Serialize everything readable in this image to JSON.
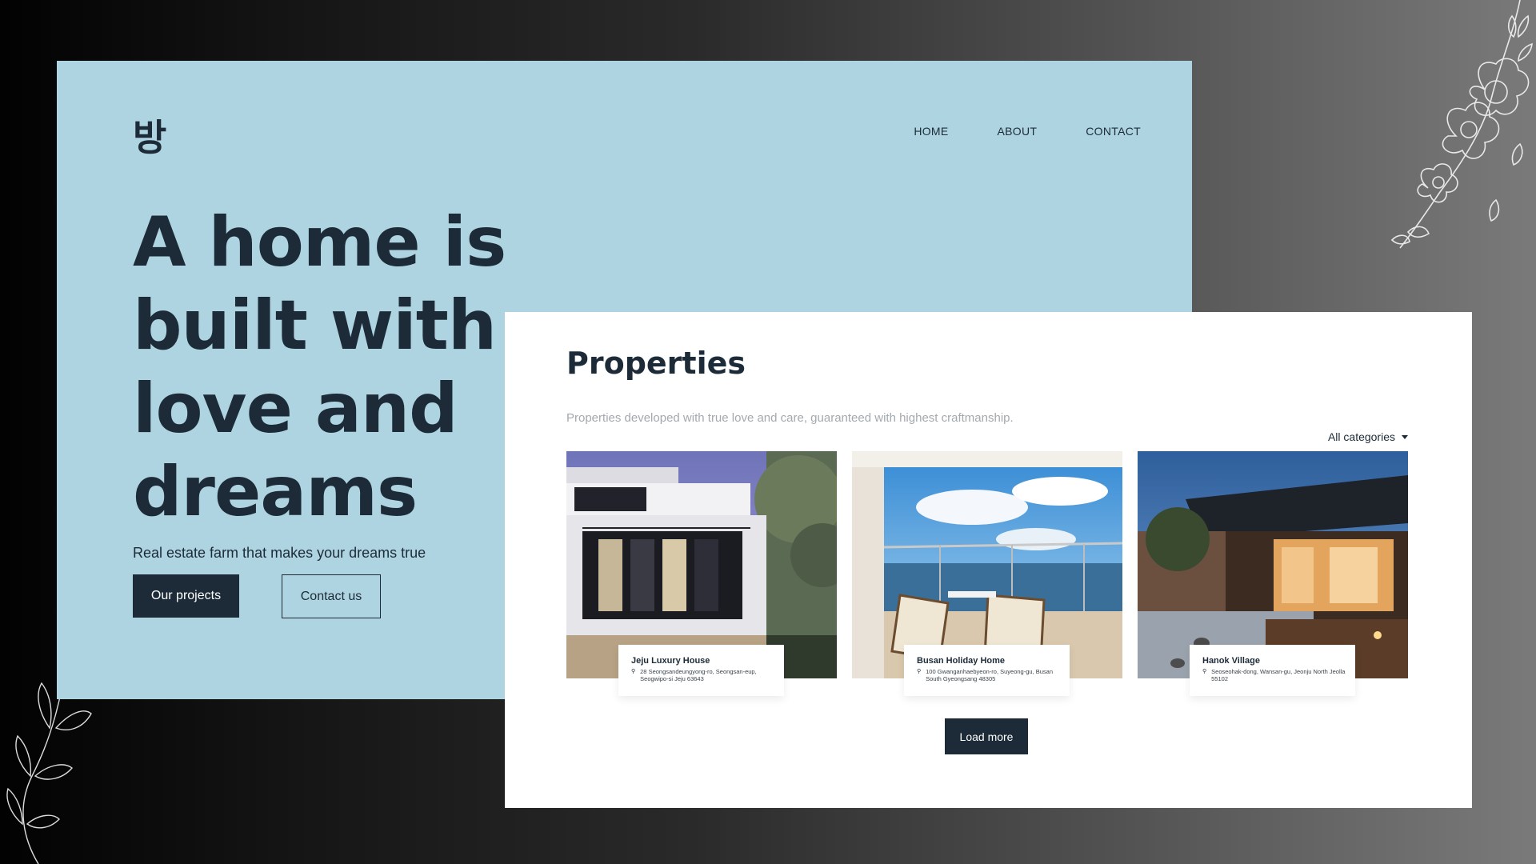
{
  "brand": {
    "logo": "방"
  },
  "nav": {
    "items": [
      "HOME",
      "ABOUT",
      "CONTACT"
    ]
  },
  "hero": {
    "headline": "A home is built with love and dreams",
    "tagline": "Real estate farm that makes your dreams true",
    "primary_button": "Our projects",
    "secondary_button": "Contact us"
  },
  "properties": {
    "title": "Properties",
    "subtitle": "Properties developed with true love and care, guaranteed with highest craftmanship.",
    "filter": {
      "selected": "All categories"
    },
    "cards": [
      {
        "name": "Jeju Luxury House",
        "address": "28 Seongsandeungyong-ro, Seongsan-eup, Seogwipo-si Jeju 63643"
      },
      {
        "name": "Busan Holiday Home",
        "address": "100 Gwanganhaebyeon-ro, Suyeong-gu, Busan South Gyeongsang 48305"
      },
      {
        "name": "Hanok Village",
        "address": "Seoseohak-dong, Wansan-gu, Jeonju North Jeolla 55102"
      }
    ],
    "load_more": "Load more"
  },
  "colors": {
    "hero_bg": "#aed4e1",
    "dark": "#1d2b38",
    "panel_bg": "#ffffff"
  }
}
